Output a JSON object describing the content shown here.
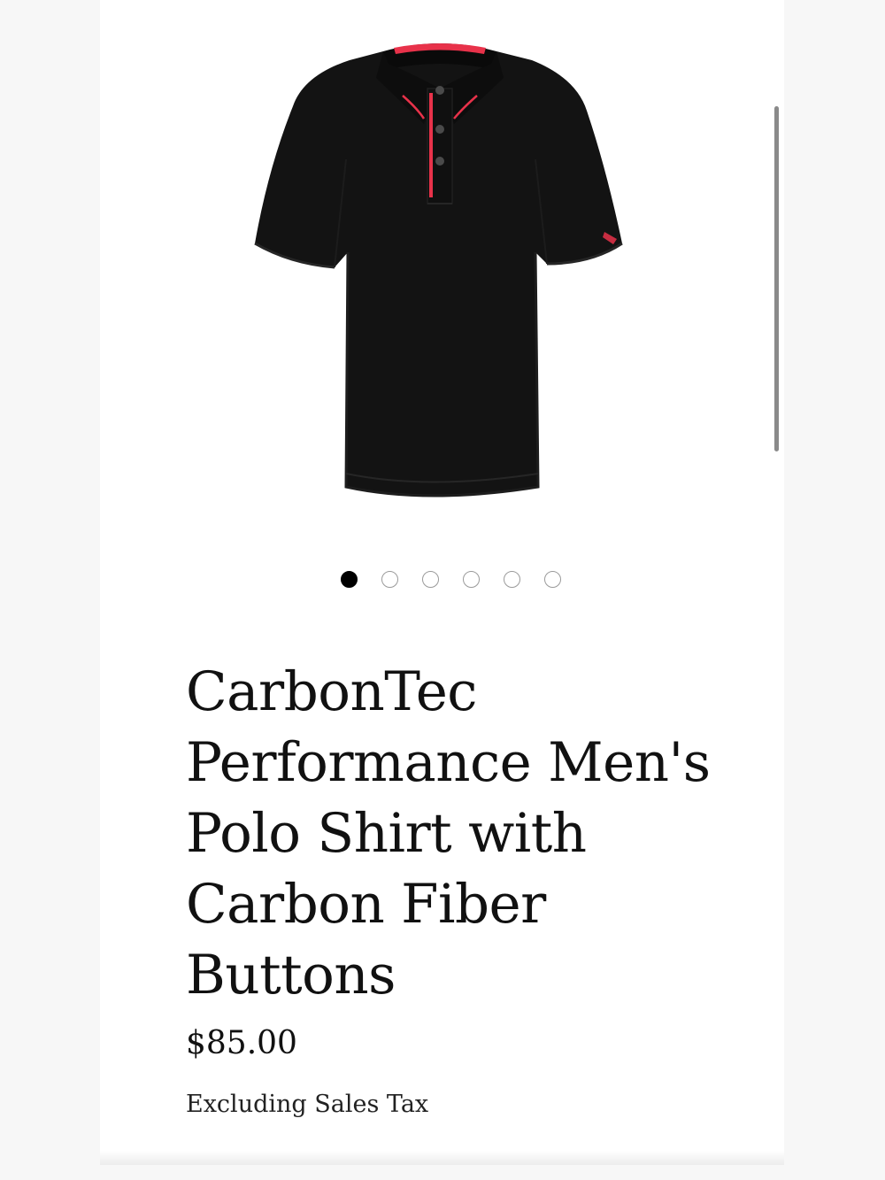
{
  "product": {
    "title": "CarbonTec Performance Men's Polo Shirt with Carbon Fiber Buttons",
    "price": "$85.00",
    "tax_note": "Excluding Sales Tax",
    "image": {
      "icon": "polo-shirt-product-image",
      "shirt_color": "#121212",
      "accent_color": "#e8324a"
    }
  },
  "gallery": {
    "total_images": 6,
    "active_index": 1,
    "dots": [
      {
        "state": "active"
      },
      {
        "state": "inactive"
      },
      {
        "state": "inactive"
      },
      {
        "state": "inactive"
      },
      {
        "state": "inactive"
      },
      {
        "state": "inactive"
      }
    ]
  }
}
